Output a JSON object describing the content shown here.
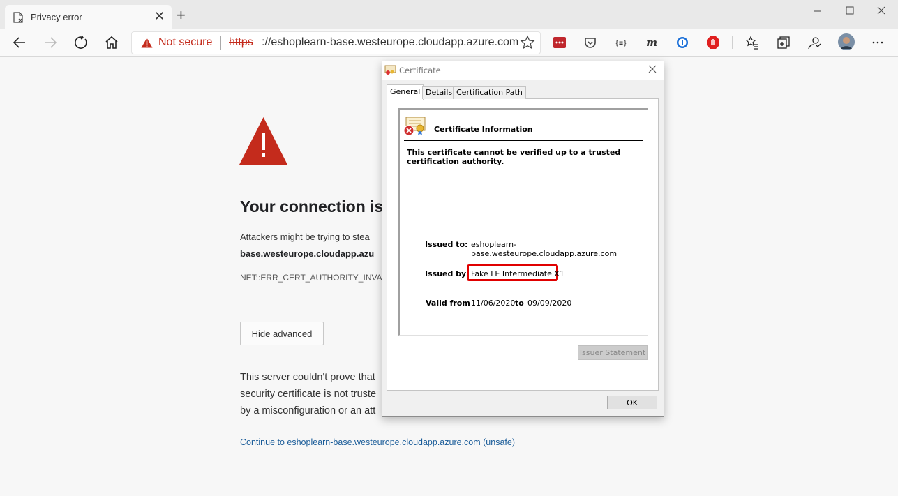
{
  "browser": {
    "tab_title": "Privacy error",
    "new_tab": "+",
    "tab_close": "✕",
    "address": {
      "security_text": "Not secure",
      "scheme": "https",
      "host_path": "://eshoplearn-base.westeurope.cloudapp.azure.com"
    }
  },
  "error_page": {
    "heading": "Your connection is",
    "desc_line1": "Attackers might be trying to stea",
    "desc_line2": "base.westeurope.cloudapp.azu",
    "error_code": "NET::ERR_CERT_AUTHORITY_INVALI",
    "hide_advanced": "Hide advanced",
    "para_line1": "This server couldn't prove that",
    "para_line2": "security certificate is not truste",
    "para_line3": "by a misconfiguration or an att",
    "continue_link": "Continue to eshoplearn-base.westeurope.cloudapp.azure.com (unsafe)"
  },
  "certificate_dialog": {
    "title": "Certificate",
    "tabs": [
      "General",
      "Details",
      "Certification Path"
    ],
    "info_title": "Certificate Information",
    "message": "This certificate cannot be verified up to a trusted certification authority.",
    "issued_to_label": "Issued to:",
    "issued_to_line1": "eshoplearn-",
    "issued_to_line2": "base.westeurope.cloudapp.azure.com",
    "issued_by_label": "Issued by:",
    "issued_by_value": "Fake LE Intermediate X1",
    "valid_from_label": "Valid from",
    "valid_from": "11/06/2020",
    "valid_to_label": "to",
    "valid_to": "09/09/2020",
    "issuer_statement": "Issuer Statement",
    "ok": "OK"
  },
  "colors": {
    "warning_red": "#c42b1c",
    "highlight_red": "#e00000",
    "link_blue": "#1a5c99"
  }
}
